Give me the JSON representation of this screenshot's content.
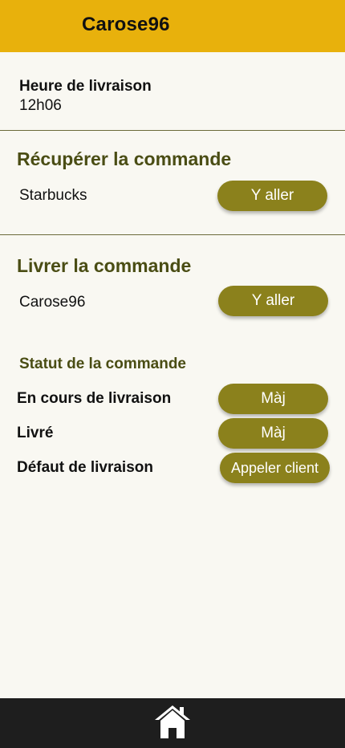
{
  "header": {
    "title": "Carose96"
  },
  "delivery_time": {
    "label": "Heure de livraison",
    "value": "12h06"
  },
  "pickup": {
    "title": "Récupérer la commande",
    "place": "Starbucks",
    "button_label": "Y aller"
  },
  "deliver": {
    "title": "Livrer la commande",
    "place": "Carose96",
    "button_label": "Y aller"
  },
  "status": {
    "title": "Statut de la commande",
    "rows": [
      {
        "label": "En cours de livraison",
        "button_label": "Màj"
      },
      {
        "label": "Livré",
        "button_label": "Màj"
      },
      {
        "label": "Défaut de livraison",
        "button_label": "Appeler client"
      }
    ]
  },
  "bottom_nav": {
    "home_icon": "home-icon"
  },
  "colors": {
    "header": "#e8b10c",
    "button": "#8b811c",
    "section_title": "#4a4d14",
    "background": "#f9f8f2",
    "bottom_bar": "#1e1e1e"
  }
}
